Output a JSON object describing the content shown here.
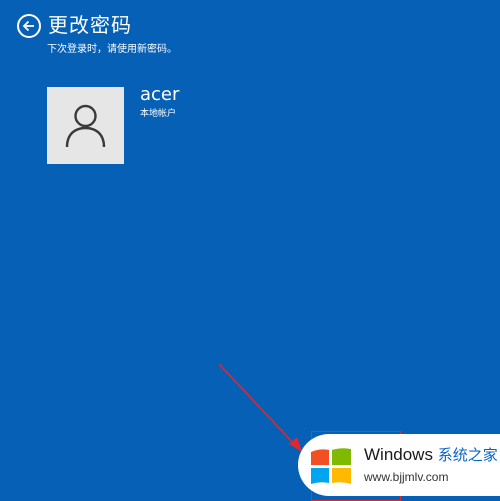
{
  "header": {
    "title": "更改密码",
    "subtitle": "下次登录时，请使用新密码。"
  },
  "account": {
    "name": "acer",
    "type": "本地帐户"
  },
  "watermark": {
    "brand": "Windows",
    "brand_cn": "系统之家",
    "url": "www.bjjmlv.com"
  },
  "icons": {
    "back": "back-arrow-icon",
    "avatar": "user-silhouette-icon",
    "watermark_logo": "windows-logo-icon"
  },
  "colors": {
    "background": "#0560b6",
    "annotation": "#e8242c"
  }
}
